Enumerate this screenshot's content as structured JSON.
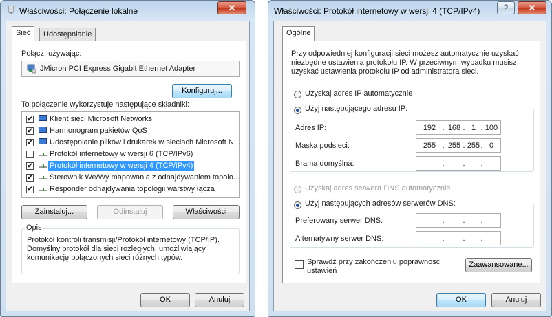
{
  "left_window": {
    "title": "Właściwości: Połączenie lokalne",
    "close_glyph": "✕",
    "tabs": [
      "Sieć",
      "Udostępnianie"
    ],
    "connect_using_label": "Połącz, używając:",
    "adapter_name": "JMicron PCI Express Gigabit Ethernet Adapter",
    "configure_button": "Konfiguruj...",
    "components_label": "To połączenie wykorzystuje następujące składniki:",
    "components": [
      {
        "label": "Klient sieci Microsoft Networks",
        "checked": true,
        "icon": "network-client-icon"
      },
      {
        "label": "Harmonogram pakietów QoS",
        "checked": true,
        "icon": "qos-scheduler-icon"
      },
      {
        "label": "Udostępnianie plików i drukarek w sieciach Microsoft N...",
        "checked": true,
        "icon": "file-sharing-icon"
      },
      {
        "label": "Protokół internetowy w wersji 6 (TCP/IPv6)",
        "checked": false,
        "icon": "protocol-icon"
      },
      {
        "label": "Protokół internetowy w wersji 4 (TCP/IPv4)",
        "checked": true,
        "icon": "protocol-icon",
        "selected": true
      },
      {
        "label": "Sterownik We/Wy mapowania z odnajdywaniem topolo...",
        "checked": true,
        "icon": "protocol-icon"
      },
      {
        "label": "Responder odnajdywania topologii warstwy łącza",
        "checked": true,
        "icon": "protocol-icon"
      }
    ],
    "install_button": "Zainstaluj...",
    "uninstall_button": "Odinstaluj",
    "properties_button": "Właściwości",
    "description_label": "Opis",
    "description_lines": [
      "Protokół kontroli transmisji/Protokół internetowy (TCP/IP).",
      "Domyślny protokół dla sieci rozległych, umożliwiający",
      "komunikację połączonych sieci różnych typów."
    ],
    "ok_button": "OK",
    "cancel_button": "Anuluj"
  },
  "right_window": {
    "title": "Właściwości: Protokół internetowy w wersji 4 (TCP/IPv4)",
    "help_glyph": "?",
    "close_glyph": "✕",
    "tabs": [
      "Ogólne"
    ],
    "intro_lines": [
      "Przy odpowiedniej konfiguracji sieci możesz automatycznie uzyskać",
      "niezbędne ustawienia protokołu IP. W przeciwnym wypadku musisz",
      "uzyskać ustawienia protokołu IP od administratora sieci."
    ],
    "ip_auto_radio": "Uzyskaj adres IP automatycznie",
    "ip_manual_radio": "Użyj następującego adresu IP:",
    "ip_address_label": "Adres IP:",
    "ip_address": [
      "192",
      "168",
      "1",
      "100"
    ],
    "subnet_label": "Maska podsieci:",
    "subnet_mask": [
      "255",
      "255",
      "255",
      "0"
    ],
    "gateway_label": "Brama domyślna:",
    "gateway": [
      "",
      "",
      "",
      ""
    ],
    "dns_auto_radio": "Uzyskaj adres serwera DNS automatycznie",
    "dns_manual_radio": "Użyj następujących adresów serwerów DNS:",
    "preferred_dns_label": "Preferowany serwer DNS:",
    "preferred_dns": [
      "",
      "",
      "",
      ""
    ],
    "alternate_dns_label": "Alternatywny serwer DNS:",
    "alternate_dns": [
      "",
      "",
      "",
      ""
    ],
    "validate_checkbox_lines": [
      "Sprawdź przy zakończeniu poprawność",
      "ustawień"
    ],
    "validate_checked": false,
    "advanced_button": "Zaawansowane...",
    "ok_button": "OK",
    "cancel_button": "Anuluj",
    "ip_dot": "."
  },
  "colors": {
    "selection": "#3399ff",
    "title_gradient_top": "#bcd4ec",
    "close_button": "#c1381d"
  }
}
